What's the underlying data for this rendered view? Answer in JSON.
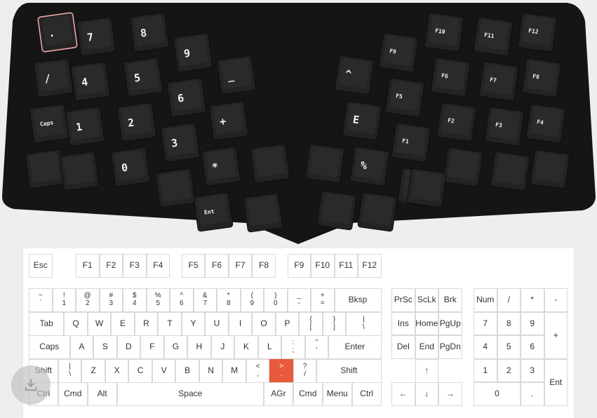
{
  "split_keyboard": {
    "left_half": {
      "col0": [
        ".",
        "/",
        "Caps",
        ""
      ],
      "col1": [
        "7",
        "4",
        "1",
        ""
      ],
      "col2": [
        "8",
        "5",
        "2",
        "0"
      ],
      "col3": [
        "9",
        "6",
        "3",
        ""
      ],
      "col4": [
        "_",
        "+",
        "*",
        "Ent"
      ],
      "thumb": [
        ""
      ]
    },
    "right_half": {
      "col0": [
        "^",
        "E",
        "%",
        ""
      ],
      "col1": [
        "F9",
        "F5",
        "F1",
        ""
      ],
      "col2": [
        "F10",
        "F6",
        "F2",
        ""
      ],
      "col3": [
        "F11",
        "F7",
        "F3",
        ""
      ],
      "col4": [
        "F12",
        "F8",
        "F4",
        ""
      ],
      "thumb": [
        ""
      ]
    },
    "selected_key": ".",
    "case_color": "#151515",
    "key_color": "#232323",
    "selection_color": "#f0a5a5"
  },
  "layout": {
    "rows": [
      [
        {
          "label": "Esc"
        },
        {
          "label": "F1"
        },
        {
          "label": "F2"
        },
        {
          "label": "F3"
        },
        {
          "label": "F4"
        },
        {
          "label": "F5"
        },
        {
          "label": "F6"
        },
        {
          "label": "F7"
        },
        {
          "label": "F8"
        },
        {
          "label": "F9"
        },
        {
          "label": "F10"
        },
        {
          "label": "F11"
        },
        {
          "label": "F12"
        }
      ],
      [
        {
          "top": "~",
          "bottom": "`"
        },
        {
          "top": "!",
          "bottom": "1"
        },
        {
          "top": "@",
          "bottom": "2"
        },
        {
          "top": "#",
          "bottom": "3"
        },
        {
          "top": "$",
          "bottom": "4"
        },
        {
          "top": "%",
          "bottom": "5"
        },
        {
          "top": "^",
          "bottom": "6"
        },
        {
          "top": "&",
          "bottom": "7"
        },
        {
          "top": "*",
          "bottom": "8"
        },
        {
          "top": "(",
          "bottom": "9"
        },
        {
          "top": ")",
          "bottom": "0"
        },
        {
          "top": "_",
          "bottom": "-"
        },
        {
          "top": "+",
          "bottom": "="
        },
        {
          "label": "Bksp"
        }
      ],
      [
        {
          "label": "Tab"
        },
        {
          "label": "Q"
        },
        {
          "label": "W"
        },
        {
          "label": "E"
        },
        {
          "label": "R"
        },
        {
          "label": "T"
        },
        {
          "label": "Y"
        },
        {
          "label": "U"
        },
        {
          "label": "I"
        },
        {
          "label": "O"
        },
        {
          "label": "P"
        },
        {
          "top": "{",
          "bottom": "["
        },
        {
          "top": "}",
          "bottom": "]"
        },
        {
          "top": "|",
          "bottom": "\\"
        }
      ],
      [
        {
          "label": "Caps"
        },
        {
          "label": "A"
        },
        {
          "label": "S"
        },
        {
          "label": "D"
        },
        {
          "label": "F"
        },
        {
          "label": "G"
        },
        {
          "label": "H"
        },
        {
          "label": "J"
        },
        {
          "label": "K"
        },
        {
          "label": "L"
        },
        {
          "top": ":",
          "bottom": ";"
        },
        {
          "top": "\"",
          "bottom": "'"
        },
        {
          "label": "Enter"
        }
      ],
      [
        {
          "label": "Shift"
        },
        {
          "top": "|",
          "bottom": "\\"
        },
        {
          "label": "Z"
        },
        {
          "label": "X"
        },
        {
          "label": "C"
        },
        {
          "label": "V"
        },
        {
          "label": "B"
        },
        {
          "label": "N"
        },
        {
          "label": "M"
        },
        {
          "top": "<",
          "bottom": ","
        },
        {
          "top": ">",
          "bottom": "."
        },
        {
          "top": "?",
          "bottom": "/"
        },
        {
          "label": "Shift"
        }
      ],
      [
        {
          "label": "Ctrl"
        },
        {
          "label": "Cmd"
        },
        {
          "label": "Alt"
        },
        {
          "label": "Space"
        },
        {
          "label": "AGr"
        },
        {
          "label": "Cmd"
        },
        {
          "label": "Menu"
        },
        {
          "label": "Ctrl"
        }
      ]
    ],
    "nav": [
      {
        "label": "PrSc"
      },
      {
        "label": "ScLk"
      },
      {
        "label": "Brk"
      },
      {
        "label": "Ins"
      },
      {
        "label": "Home"
      },
      {
        "label": "PgUp"
      },
      {
        "label": "Del"
      },
      {
        "label": "End"
      },
      {
        "label": "PgDn"
      },
      {
        "label": "↑"
      },
      {
        "label": "←"
      },
      {
        "label": "↓"
      },
      {
        "label": "→"
      }
    ],
    "numpad": [
      {
        "label": "Num"
      },
      {
        "label": "/"
      },
      {
        "label": "*"
      },
      {
        "label": "-"
      },
      {
        "label": "7"
      },
      {
        "label": "8"
      },
      {
        "label": "9"
      },
      {
        "label": "+"
      },
      {
        "label": "4"
      },
      {
        "label": "5"
      },
      {
        "label": "6"
      },
      {
        "label": "1"
      },
      {
        "label": "2"
      },
      {
        "label": "3"
      },
      {
        "label": "Ent"
      },
      {
        "label": "0"
      },
      {
        "label": "."
      }
    ],
    "highlighted_key": ">",
    "highlight_color": "#e85a3c"
  },
  "download_button": {
    "icon": "download-icon"
  }
}
